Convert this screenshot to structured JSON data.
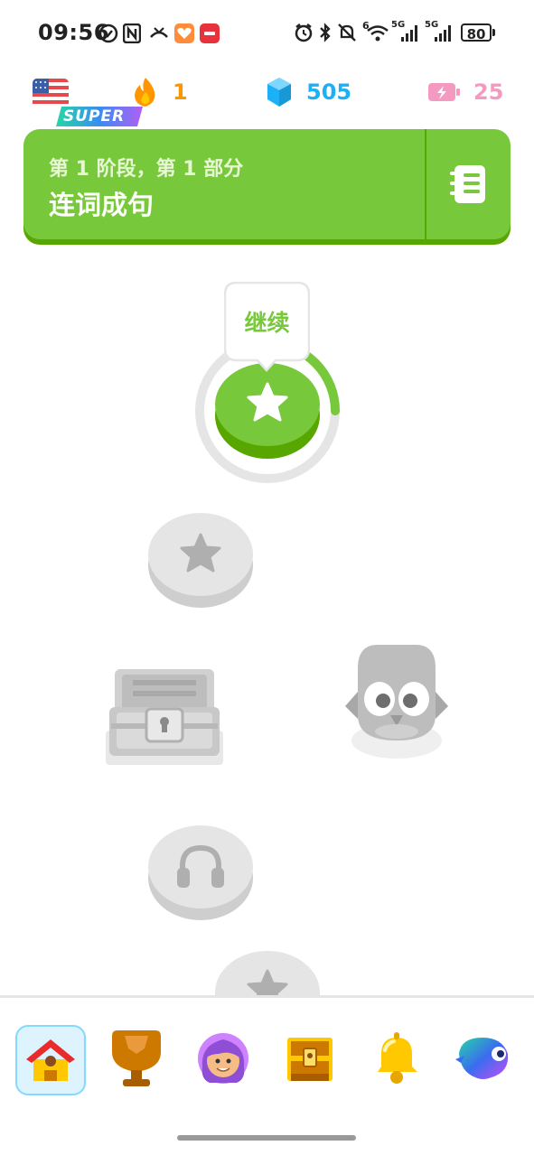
{
  "status_bar": {
    "time": "09:56",
    "battery": "80",
    "network_1": "5G",
    "network_2": "5G",
    "wifi_badge": "6"
  },
  "stats": {
    "streak": "1",
    "gems": "505",
    "energy": "25",
    "super_label": "SUPER",
    "colors": {
      "streak": "#ff9600",
      "gems": "#1cb0f6",
      "energy": "#f49ac1",
      "green": "#78c83c"
    }
  },
  "unit": {
    "subtitle": "第 1 阶段，第 1 部分",
    "title": "连词成句"
  },
  "path": {
    "tooltip_label": "继续",
    "current_progress": 0.25
  },
  "nav": {
    "items": [
      "home-icon",
      "trophy-icon",
      "profile-avatar",
      "treasure-chest-icon",
      "bell-icon",
      "duolingo-max-icon"
    ]
  }
}
